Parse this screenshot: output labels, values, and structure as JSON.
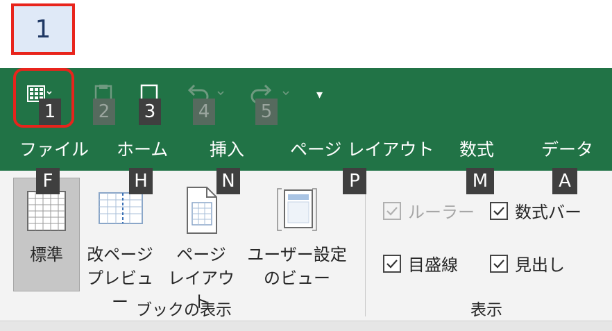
{
  "callout": {
    "number": "1"
  },
  "qat": {
    "buttons": [
      {
        "name": "normal-view",
        "key": "1",
        "enabled": true
      },
      {
        "name": "save",
        "key": "2",
        "enabled": false
      },
      {
        "name": "touch-mode",
        "key": "3",
        "enabled": true
      },
      {
        "name": "undo",
        "key": "4",
        "enabled": false
      },
      {
        "name": "redo",
        "key": "5",
        "enabled": false
      }
    ],
    "customize_glyph": "▾"
  },
  "tabs": [
    {
      "label": "ファイル",
      "key": "F"
    },
    {
      "label": "ホーム",
      "key": "H"
    },
    {
      "label": "挿入",
      "key": "N"
    },
    {
      "label": "ページ レイアウト",
      "key": "P"
    },
    {
      "label": "数式",
      "key": "M"
    },
    {
      "label": "データ",
      "key": "A"
    }
  ],
  "workbook_views": {
    "group_label": "ブックの表示",
    "buttons": [
      {
        "line1": "標準",
        "line2": "",
        "selected": true
      },
      {
        "line1": "改ページ",
        "line2": "プレビュー",
        "selected": false
      },
      {
        "line1": "ページ",
        "line2": "レイアウト",
        "selected": false
      },
      {
        "line1": "ユーザー設定",
        "line2": "のビュー",
        "selected": false
      }
    ]
  },
  "show": {
    "group_label": "表示",
    "checkboxes": [
      {
        "label": "ルーラー",
        "checked": true,
        "disabled": true
      },
      {
        "label": "数式バー",
        "checked": true,
        "disabled": false
      },
      {
        "label": "目盛線",
        "checked": true,
        "disabled": false
      },
      {
        "label": "見出し",
        "checked": true,
        "disabled": false
      }
    ]
  },
  "colors": {
    "excel_green": "#217346",
    "highlight_red": "#e8241c",
    "keytip_bg": "#3f3f3f"
  }
}
